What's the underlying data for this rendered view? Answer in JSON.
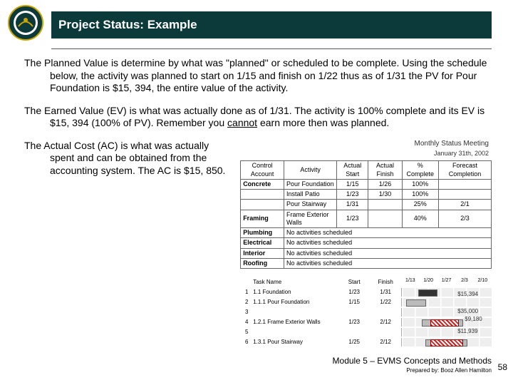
{
  "header": {
    "title": "Project Status: Example"
  },
  "body": {
    "p1_a": "The Planned Value is determine by what was \"planned\" or scheduled to be complete.  Using the schedule below, the activity was planned to start on 1/15 and finish on 1/22 thus as of 1/31 the PV for Pour Foundation is $15, 394, the entire value of the activity.",
    "p2_a": "The Earned Value (EV) is what was actually done as of 1/31.  The activity is 100% complete and its EV is $15, 394 (100% of PV).  Remember you ",
    "p2_u": "cannot",
    "p2_b": " earn more then was planned.",
    "p3": "The Actual Cost (AC) is what was actually spent and can be obtained from the accounting system.  The AC is $15, 850."
  },
  "figure": {
    "title": "Monthly Status Meeting",
    "date": "January 31th, 2002",
    "cols": {
      "ca": "Control Account",
      "act": "Activity",
      "as": "Actual Start",
      "af": "Actual Finish",
      "pc": "% Complete",
      "fc": "Forecast Completion"
    },
    "rows": [
      {
        "ca": "Concrete",
        "act": "Pour Foundation",
        "as": "1/15",
        "af": "1/26",
        "pc": "100%",
        "fc": ""
      },
      {
        "ca": "",
        "act": "Install Patio",
        "as": "1/23",
        "af": "1/30",
        "pc": "100%",
        "fc": ""
      },
      {
        "ca": "",
        "act": "Pour Stairway",
        "as": "1/31",
        "af": "",
        "pc": "25%",
        "fc": "2/1"
      },
      {
        "ca": "Framing",
        "act": "Frame Exterior Walls",
        "as": "1/23",
        "af": "",
        "pc": "40%",
        "fc": "2/3"
      },
      {
        "ca": "Plumbing",
        "act": "No activities scheduled",
        "as": "",
        "af": "",
        "pc": "",
        "fc": ""
      },
      {
        "ca": "Electrical",
        "act": "No activities scheduled",
        "as": "",
        "af": "",
        "pc": "",
        "fc": ""
      },
      {
        "ca": "Interior",
        "act": "No activities scheduled",
        "as": "",
        "af": "",
        "pc": "",
        "fc": ""
      },
      {
        "ca": "Roofing",
        "act": "No activities scheduled",
        "as": "",
        "af": "",
        "pc": "",
        "fc": ""
      }
    ]
  },
  "gantt": {
    "headers": {
      "id": "",
      "task": "Task Name",
      "start": "Start",
      "finish": "Finish"
    },
    "ticks": [
      "1/13",
      "1/20",
      "1/27",
      "2/3",
      "2/10"
    ],
    "labels": {
      "pv": "$15,394",
      "ev": "$35,000",
      "ac": "$9,180",
      "total": "$11,939"
    },
    "tasks": [
      {
        "id": "1",
        "name": "1.1 Foundation",
        "start": "1/23",
        "finish": "1/31"
      },
      {
        "id": "2",
        "name": "1.1.1 Pour Foundation",
        "start": "1/15",
        "finish": "1/22"
      },
      {
        "id": "3",
        "name": "",
        "start": "",
        "finish": ""
      },
      {
        "id": "4",
        "name": "1.2.1 Frame Exterior Walls",
        "start": "1/23",
        "finish": "2/12"
      },
      {
        "id": "5",
        "name": "",
        "start": "",
        "finish": ""
      },
      {
        "id": "6",
        "name": "1.3.1 Pour Stairway",
        "start": "1/25",
        "finish": "2/12"
      }
    ]
  },
  "footer": {
    "module": "Module 5 – EVMS Concepts and Methods",
    "prepared": "Prepared by: Booz Allen Hamilton",
    "page": "58"
  }
}
